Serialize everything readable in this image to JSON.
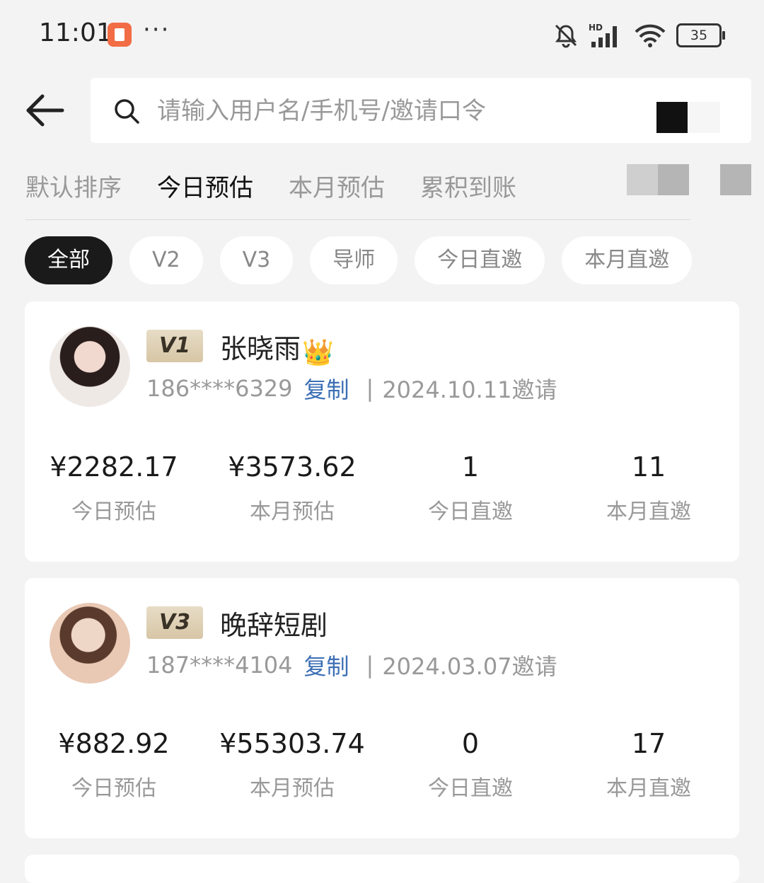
{
  "status_bar": {
    "time": "11:01",
    "dots": "···",
    "battery": "35",
    "icons": [
      "app-notification-icon",
      "bell-off-icon",
      "signal-icon",
      "wifi-icon",
      "battery-icon"
    ]
  },
  "header": {
    "search_placeholder": "请输入用户名/手机号/邀请口令"
  },
  "sort_tabs": [
    {
      "label": "默认排序",
      "active": false
    },
    {
      "label": "今日预估",
      "active": true
    },
    {
      "label": "本月预估",
      "active": false
    },
    {
      "label": "累积到账",
      "active": false
    }
  ],
  "filter_chips": [
    {
      "label": "全部",
      "active": true
    },
    {
      "label": "V2",
      "active": false
    },
    {
      "label": "V3",
      "active": false
    },
    {
      "label": "导师",
      "active": false
    },
    {
      "label": "今日直邀",
      "active": false
    },
    {
      "label": "本月直邀",
      "active": false
    }
  ],
  "users": [
    {
      "level": "V1",
      "name": "张晓雨",
      "has_crown": true,
      "phone": "186****6329",
      "copy_label": "复制",
      "invite_date": "2024.10.11邀请",
      "stats": [
        {
          "value": "¥2282.17",
          "label": "今日预估"
        },
        {
          "value": "¥3573.62",
          "label": "本月预估"
        },
        {
          "value": "1",
          "label": "今日直邀"
        },
        {
          "value": "11",
          "label": "本月直邀"
        }
      ]
    },
    {
      "level": "V3",
      "name": "晚辞短剧",
      "has_crown": false,
      "phone": "187****4104",
      "copy_label": "复制",
      "invite_date": "2024.03.07邀请",
      "stats": [
        {
          "value": "¥882.92",
          "label": "今日预估"
        },
        {
          "value": "¥55303.74",
          "label": "本月预估"
        },
        {
          "value": "0",
          "label": "今日直邀"
        },
        {
          "value": "17",
          "label": "本月直邀"
        }
      ]
    }
  ],
  "colors": {
    "accent_link": "#3c6fb5",
    "chip_active_bg": "#1a1a1a",
    "badge_gold": "#d7c6a6",
    "page_bg": "#f3f3f3"
  }
}
